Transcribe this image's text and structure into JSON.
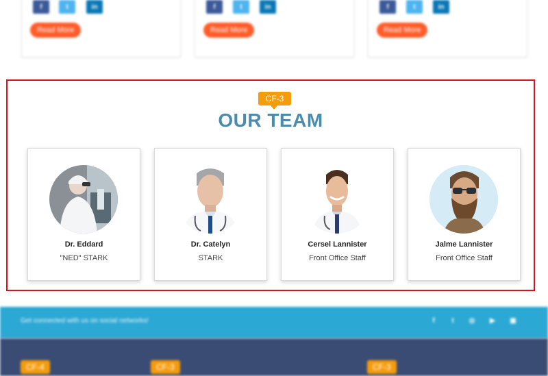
{
  "blog": {
    "social": [
      "f",
      "t",
      "in"
    ],
    "read_more": "Read More"
  },
  "team": {
    "badge": "CF-3",
    "title": "OUR TEAM",
    "members": [
      {
        "name": "Dr. Eddard",
        "role": "\"NED\" STARK"
      },
      {
        "name": "Dr. Catelyn",
        "role": "STARK"
      },
      {
        "name": "Cersel Lannister",
        "role": "Front Office Staff"
      },
      {
        "name": "Jalme Lannister",
        "role": "Front Office Staff"
      }
    ]
  },
  "footer": {
    "connect_text": "Get connected with us on social networks!",
    "social": [
      "f",
      "t",
      "◎",
      "▶",
      "▣"
    ],
    "badges": [
      "CF-4",
      "CF-3",
      "CF-3"
    ]
  },
  "colors": {
    "accent_title": "#4a8cae",
    "badge": "#f59c0c",
    "band": "#2ba8d3",
    "footer": "#3a4c74",
    "highlight_border": "#d9121c"
  }
}
